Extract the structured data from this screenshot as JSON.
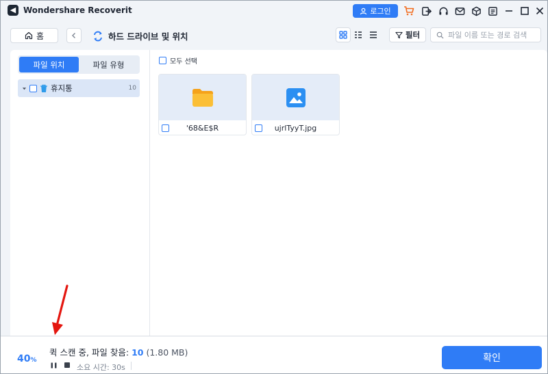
{
  "app": {
    "title": "Wondershare Recoverit",
    "logo_glyph": "◀",
    "login_label": "로그인"
  },
  "toolbar": {
    "home_label": "홈",
    "location_title": "하드 드라이브 및 위치",
    "filter_label": "필터",
    "search_placeholder": "파일 이름 또는 경로 검색",
    "active_view": "grid"
  },
  "sidebar": {
    "tabs": [
      {
        "label": "파일 위치",
        "active": true
      },
      {
        "label": "파일 유형",
        "active": false
      }
    ],
    "tree": [
      {
        "label": "휴지통",
        "count": "10",
        "expanded": true
      }
    ]
  },
  "main": {
    "select_all_label": "모두 선택",
    "files": [
      {
        "name": "'68&E$R",
        "type": "folder",
        "icon": "folder-icon"
      },
      {
        "name": "ujrlTyyT.jpg",
        "type": "image",
        "icon": "image-icon"
      }
    ]
  },
  "status": {
    "progress_value": "40",
    "progress_unit": "%",
    "scan_prefix": "퀵 스캔 중, 파일 찾음: ",
    "found_count": "10",
    "found_size": "(1.80 MB)",
    "elapsed": "소요 시간: 30s",
    "confirm_label": "확인"
  },
  "colors": {
    "accent": "#2f7cf6",
    "folder": "#f7a823",
    "annotation": "#e4160f"
  }
}
